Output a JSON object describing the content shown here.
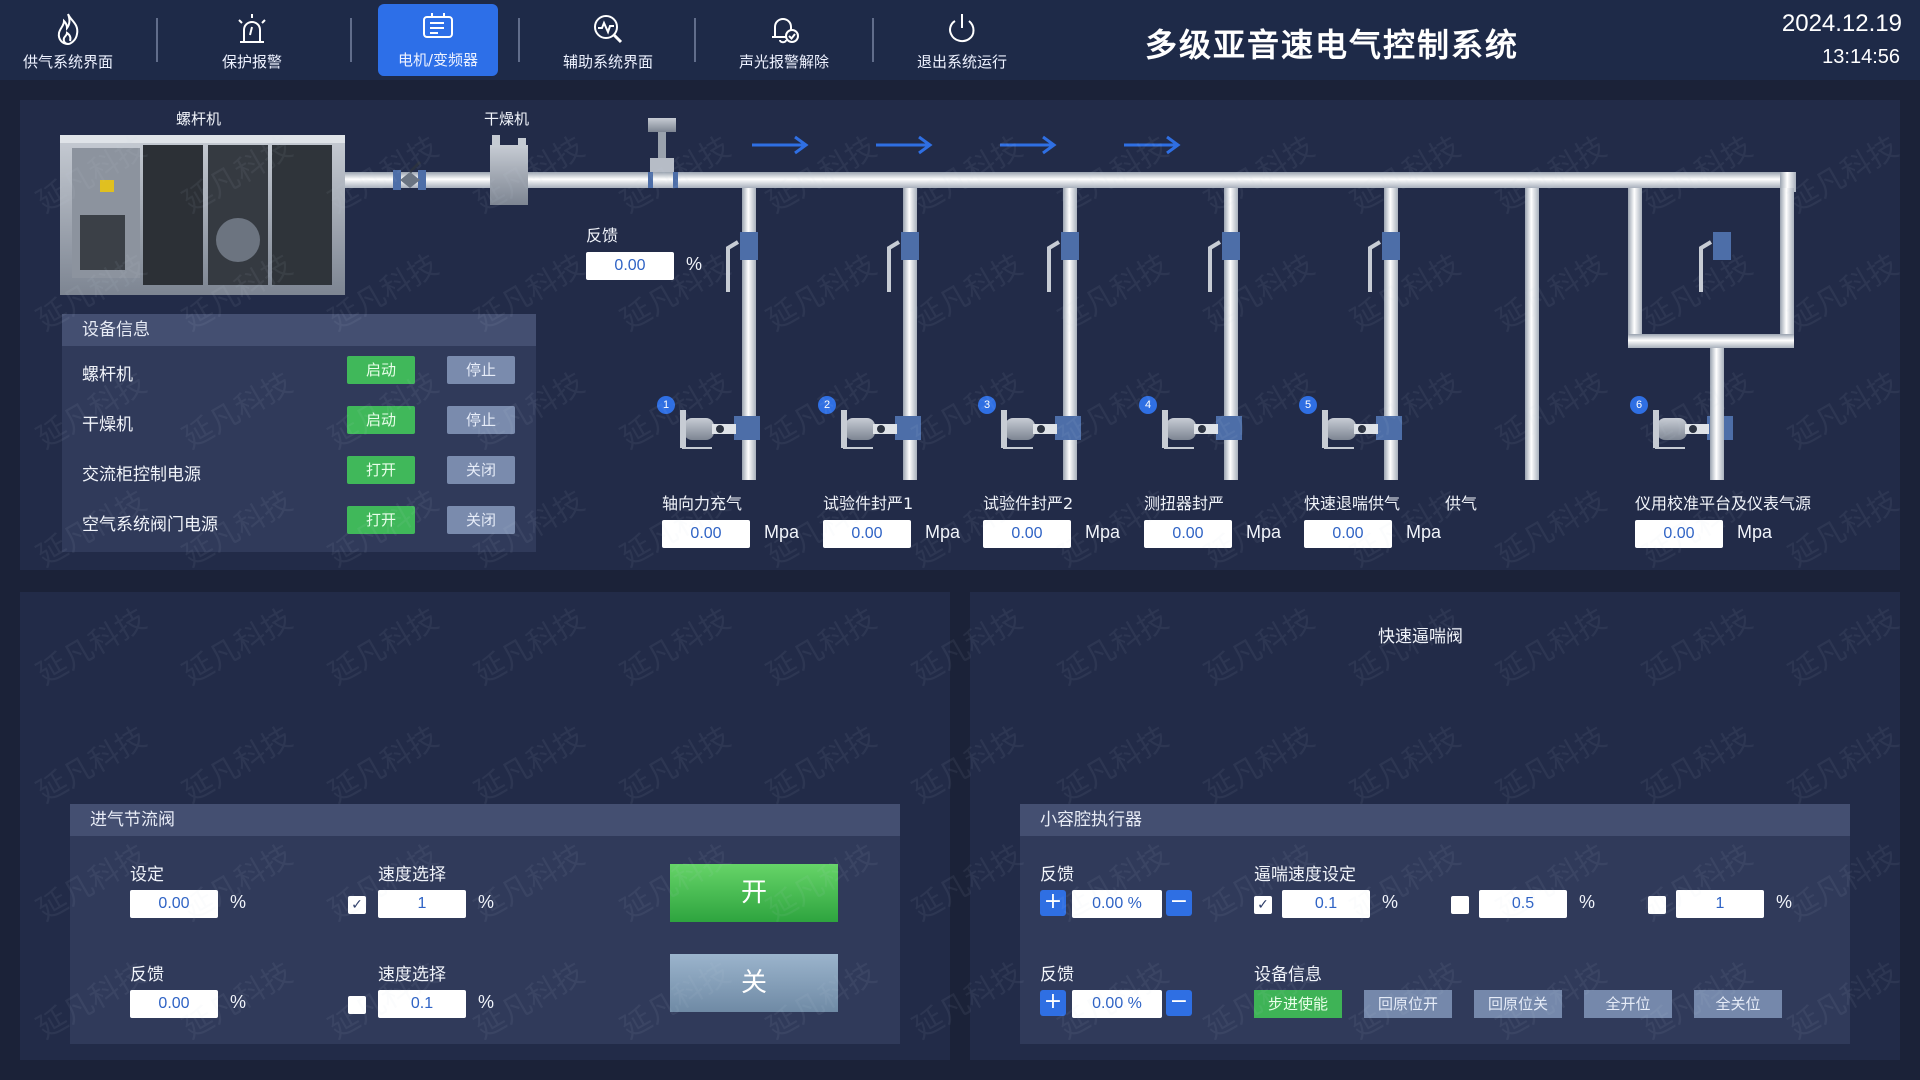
{
  "nav": [
    {
      "label": "供气系统界面",
      "icon": "flame-icon"
    },
    {
      "label": "保护报警",
      "icon": "alarm-light-icon"
    },
    {
      "label": "电机/变频器",
      "icon": "motor-drive-icon"
    },
    {
      "label": "辅助系统界面",
      "icon": "analysis-magnifier-icon"
    },
    {
      "label": "声光报警解除",
      "icon": "bell-check-icon"
    },
    {
      "label": "退出系统运行",
      "icon": "power-icon"
    }
  ],
  "header": {
    "title": "多级亚音速电气控制系统",
    "date": "2024.12.19",
    "time": "13:14:56"
  },
  "colors": {
    "accent": "#2d6fe8",
    "panel": "#222b48",
    "background": "#1b2238",
    "green": "#40b85a"
  },
  "supply": {
    "compressor_label": "螺杆机",
    "dryer_label": "干燥机",
    "feedback_label": "反馈",
    "feedback_value": "0.00",
    "percent_unit": "%",
    "branches": [
      {
        "num": "1",
        "label": "轴向力充气",
        "value": "0.00",
        "unit": "Mpa"
      },
      {
        "num": "2",
        "label": "试验件封严1",
        "value": "0.00",
        "unit": "Mpa"
      },
      {
        "num": "3",
        "label": "试验件封严2",
        "value": "0.00",
        "unit": "Mpa"
      },
      {
        "num": "4",
        "label": "测扭器封严",
        "value": "0.00",
        "unit": "Mpa"
      },
      {
        "num": "5",
        "label": "快速退喘供气",
        "value": "0.00",
        "unit": "Mpa"
      },
      {
        "num": "",
        "label": "供气",
        "value": "",
        "unit": ""
      },
      {
        "num": "6",
        "label": "仪用校准平台及仪表气源",
        "value": "0.00",
        "unit": "Mpa"
      }
    ]
  },
  "device_info": {
    "title": "设备信息",
    "rows": [
      {
        "label": "螺杆机",
        "on": "启动",
        "off": "停止"
      },
      {
        "label": "干燥机",
        "on": "启动",
        "off": "停止"
      },
      {
        "label": "交流柜控制电源",
        "on": "打开",
        "off": "关闭"
      },
      {
        "label": "空气系统阀门电源",
        "on": "打开",
        "off": "关闭"
      }
    ]
  },
  "intake": {
    "title": "进气节流阀",
    "set_label": "设定",
    "set_value": "0.00",
    "feedback_label": "反馈",
    "feedback_value": "0.00",
    "unit": "%",
    "speed1_label": "速度选择",
    "speed1_value": "1",
    "speed1_checked": true,
    "speed2_label": "速度选择",
    "speed2_value": "0.1",
    "speed2_checked": false,
    "open_label": "开",
    "close_label": "关"
  },
  "actuator": {
    "valve_label": "快速逼喘阀",
    "title": "小容腔执行器",
    "feedback1_label": "反馈",
    "feedback1_value": "0.00",
    "feedback2_label": "反馈",
    "feedback2_value": "0.00",
    "unit": "%",
    "plus_symbol": "+",
    "minus_symbol": "−",
    "speed_label": "逼喘速度设定",
    "speeds": [
      {
        "value": "0.1",
        "checked": true
      },
      {
        "value": "0.5",
        "checked": false
      },
      {
        "value": "1",
        "checked": false
      }
    ],
    "device_label": "设备信息",
    "buttons": [
      "步进使能",
      "回原位开",
      "回原位关",
      "全开位",
      "全关位"
    ]
  },
  "watermark": "延凡科技"
}
